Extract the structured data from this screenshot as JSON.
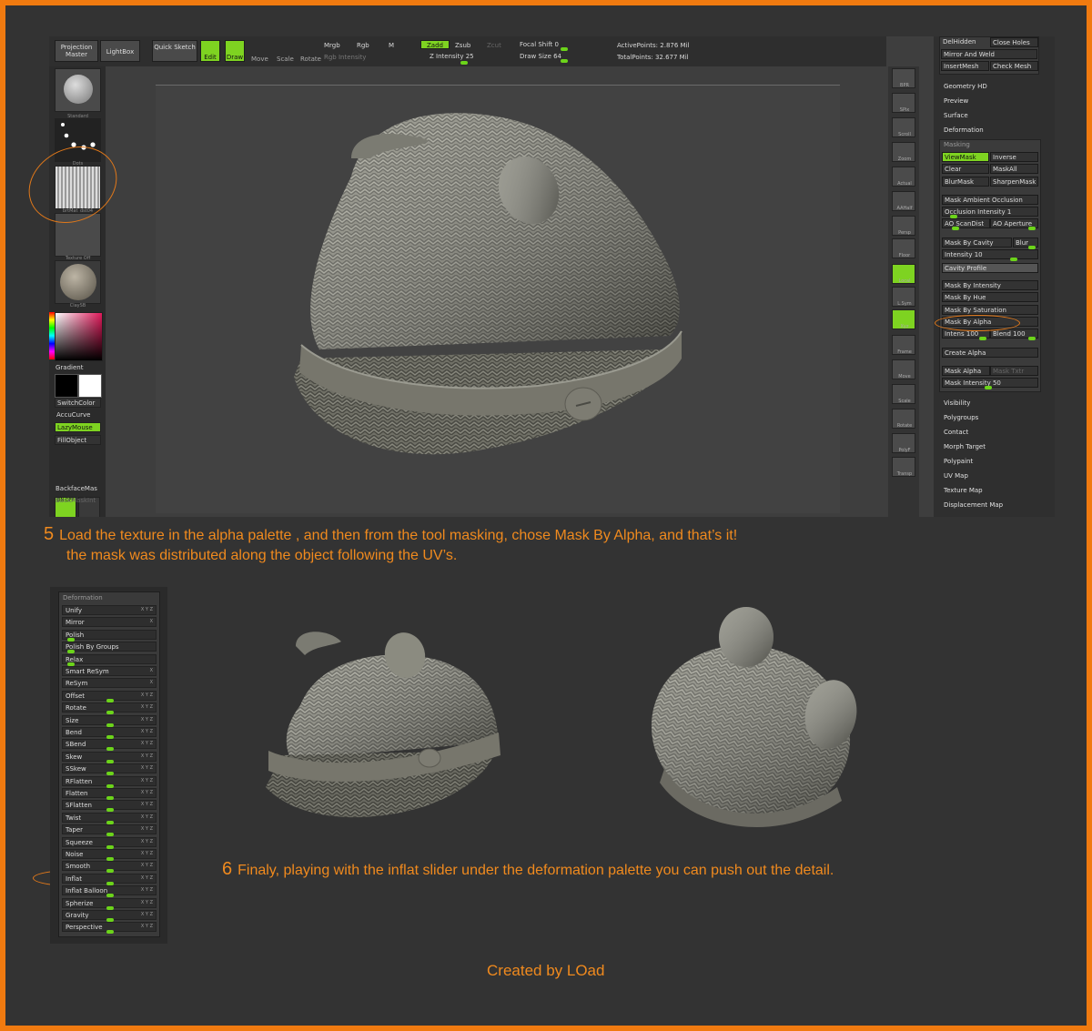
{
  "top_toolbar": {
    "projection_master": "Projection Master",
    "lightbox": "LightBox",
    "quick_sketch": "Quick Sketch",
    "edit": "Edit",
    "draw": "Draw",
    "move": "Move",
    "scale": "Scale",
    "rotate": "Rotate",
    "mrgb": "Mrgb",
    "rgb": "Rgb",
    "m": "M",
    "rgb_intensity": "Rgb Intensity",
    "zadd": "Zadd",
    "zsub": "Zsub",
    "zcut": "Zcut",
    "z_intensity": "Z Intensity 25",
    "focal_shift": "Focal Shift 0",
    "draw_size": "Draw Size 64",
    "active_points": "ActivePoints: 2.876  Mil",
    "total_points": "TotalPoints: 32.677  Mil"
  },
  "left_column": {
    "brush_label": "Standard",
    "stroke_label": "Dots",
    "alpha_label": "brtMat_dst04",
    "texture_label": "Texture Off",
    "material_label": "ClaySB",
    "gradient": "Gradient",
    "switch_color": "SwitchColor",
    "accu_curve": "AccuCurve",
    "lazy_mouse": "LazyMouse",
    "fill_object": "FillObject",
    "on_off": "ON OFF",
    "backface_mask": "BackfaceMas",
    "back_mask_int": "BackMaskInt"
  },
  "right_strip": [
    "BPR",
    "SPix",
    "Scroll",
    "Zoom",
    "Actual",
    "AAHalf",
    "Persp",
    "Floor",
    "Local",
    "L.Sym",
    "Xyz",
    "Frame",
    "Move",
    "Scale",
    "Rotate",
    "PolyF",
    "Transp"
  ],
  "right_panel": {
    "top_buttons": [
      "DelHidden",
      "Close Holes",
      "Mirror And Weld",
      "InsertMesh",
      "Check Mesh"
    ],
    "sections_top": [
      "Geometry HD",
      "Preview",
      "Surface",
      "Deformation"
    ],
    "masking_title": "Masking",
    "masking_buttons": {
      "view_mask": "ViewMask",
      "inverse": "Inverse",
      "clear": "Clear",
      "mask_all": "MaskAll",
      "blur_mask": "BlurMask",
      "sharpen_mask": "SharpenMask",
      "mask_ao": "Mask Ambient Occlusion",
      "occlusion_intensity": "Occlusion Intensity 1",
      "ao_scandist": "AO ScanDist",
      "ao_aperture": "AO Aperture",
      "mask_by_cavity": "Mask By Cavity",
      "blur": "Blur",
      "intensity": "Intensity 10",
      "cavity_profile": "Cavity Profile",
      "mask_by_intensity": "Mask By Intensity",
      "mask_by_hue": "Mask By Hue",
      "mask_by_saturation": "Mask By Saturation",
      "mask_by_alpha": "Mask By Alpha",
      "intens": "Intens 100",
      "blend": "Blend 100",
      "create_alpha": "Create Alpha",
      "mask_alpha": "Mask Alpha",
      "mask_txtr": "Mask Txtr",
      "mask_intensity": "Mask Intensity 50"
    },
    "sections_bottom": [
      "Visibility",
      "Polygroups",
      "Contact",
      "Morph Target",
      "Polypaint",
      "UV Map",
      "Texture Map",
      "Displacement Map"
    ]
  },
  "captions": {
    "step5_num": "5",
    "step5_line1": "Load the texture in the alpha palette , and then from the tool masking, chose Mask By Alpha, and that’s it!",
    "step5_line2": "the mask was distributed along the object following the UV’s.",
    "step6_num": "6",
    "step6_text": "Finaly, playing with the inflat slider under the deformation palette you can push out the detail.",
    "credit": "Created by LOad"
  },
  "deformation_panel": {
    "title": "Deformation",
    "items": [
      {
        "label": "Unify",
        "axes": "X Y Z",
        "slider": 0
      },
      {
        "label": "Mirror",
        "axes": "X",
        "slider": 0
      },
      {
        "label": "Polish",
        "axes": "",
        "slider": 0.05
      },
      {
        "label": "Polish By Groups",
        "axes": "",
        "slider": 0.05
      },
      {
        "label": "Relax",
        "axes": "",
        "slider": 0.05
      },
      {
        "label": "Smart ReSym",
        "axes": "X",
        "slider": 0
      },
      {
        "label": "ReSym",
        "axes": "X",
        "slider": 0
      },
      {
        "label": "Offset",
        "axes": "X Y Z",
        "slider": 0.5
      },
      {
        "label": "Rotate",
        "axes": "X Y Z",
        "slider": 0.5
      },
      {
        "label": "Size",
        "axes": "X Y Z",
        "slider": 0.5
      },
      {
        "label": "Bend",
        "axes": "X Y Z",
        "slider": 0.5
      },
      {
        "label": "SBend",
        "axes": "X Y Z",
        "slider": 0.5
      },
      {
        "label": "Skew",
        "axes": "X Y Z",
        "slider": 0.5
      },
      {
        "label": "SSkew",
        "axes": "X Y Z",
        "slider": 0.5
      },
      {
        "label": "RFlatten",
        "axes": "X Y Z",
        "slider": 0.5
      },
      {
        "label": "Flatten",
        "axes": "X Y Z",
        "slider": 0.5
      },
      {
        "label": "SFlatten",
        "axes": "X Y Z",
        "slider": 0.5
      },
      {
        "label": "Twist",
        "axes": "X Y Z",
        "slider": 0.5
      },
      {
        "label": "Taper",
        "axes": "X Y Z",
        "slider": 0.5
      },
      {
        "label": "Squeeze",
        "axes": "X Y Z",
        "slider": 0.5
      },
      {
        "label": "Noise",
        "axes": "X Y Z",
        "slider": 0.5
      },
      {
        "label": "Smooth",
        "axes": "X Y Z",
        "slider": 0.5
      },
      {
        "label": "Inflat",
        "axes": "X Y Z",
        "slider": 0.5
      },
      {
        "label": "Inflat Balloon",
        "axes": "X Y Z",
        "slider": 0.5
      },
      {
        "label": "Spherize",
        "axes": "X Y Z",
        "slider": 0.5
      },
      {
        "label": "Gravity",
        "axes": "X Y Z",
        "slider": 0.5
      },
      {
        "label": "Perspective",
        "axes": "X Y Z",
        "slider": 0.5
      }
    ]
  },
  "colors": {
    "accent_orange": "#f07a10",
    "active_green": "#7ed321",
    "panel_dark": "#2f2f2f"
  }
}
